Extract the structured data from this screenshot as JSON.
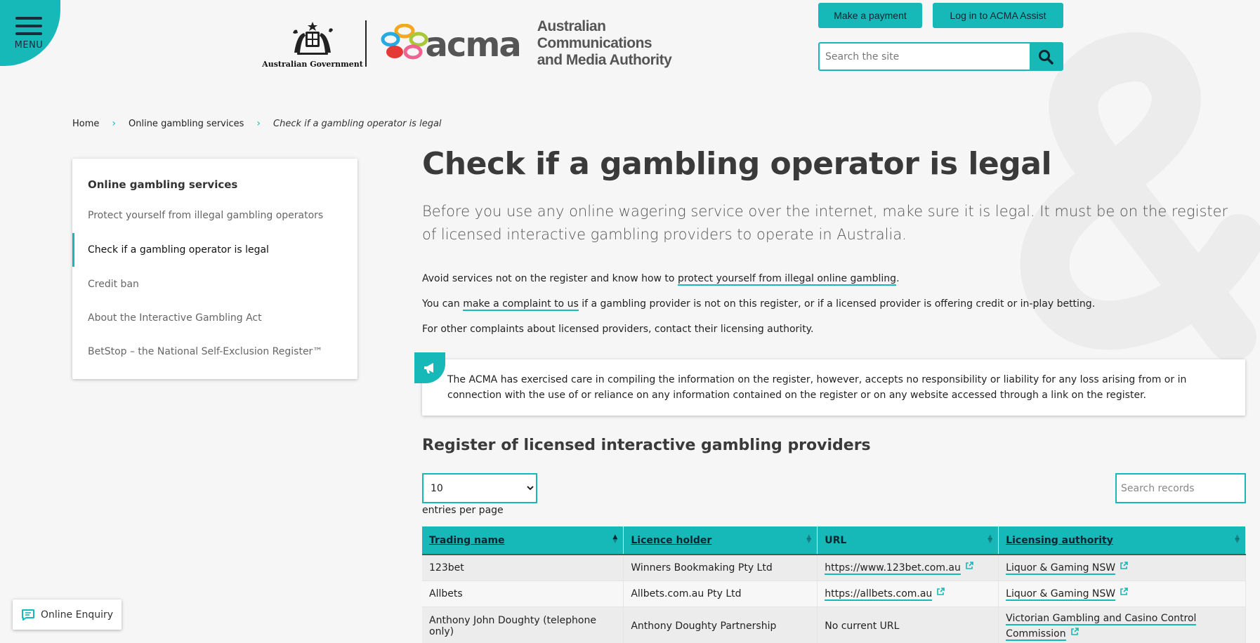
{
  "menu": {
    "label": "MENU"
  },
  "logo": {
    "govt_text": "Australian Government",
    "acma_word": "acma",
    "acma_name": [
      "Australian",
      "Communications",
      "and Media Authority"
    ]
  },
  "header": {
    "payment_label": "Make a payment",
    "login_label": "Log in to ACMA Assist",
    "search_placeholder": "Search the site"
  },
  "breadcrumb": {
    "home": "Home",
    "section": "Online gambling services",
    "current": "Check if a gambling operator is legal"
  },
  "sidenav": {
    "title": "Online gambling services",
    "items": [
      {
        "label": "Protect yourself from illegal gambling operators"
      },
      {
        "label": "Check if a gambling operator is legal"
      },
      {
        "label": "Credit ban"
      },
      {
        "label": "About the Interactive Gambling Act"
      },
      {
        "label": "BetStop – the National Self-Exclusion Register™"
      }
    ]
  },
  "main": {
    "title": "Check if a gambling operator is legal",
    "lead": "Before you use any online wagering service over the internet, make sure it is legal. It must be on the register of licensed interactive gambling providers to operate in Australia.",
    "para1_before": "Avoid services not on the register and know how to ",
    "para1_link": "protect yourself from illegal online gambling",
    "para1_after": ".",
    "para2_before": "You can ",
    "para2_link": "make a complaint to us",
    "para2_after": " if a gambling provider is not on this register, or if a licensed provider is offering credit or in-play betting.",
    "para3": "For other complaints about licensed providers, contact their licensing authority."
  },
  "notice": {
    "text": "The ACMA has exercised care in compiling the information on the register, however, accepts no responsibility or liability for any loss arising from or in connection with the use of or reliance on any information contained on the register or on any website accessed through a link on the register."
  },
  "register": {
    "title": "Register of licensed interactive gambling providers",
    "per_page_value": "10",
    "per_page_label": "entries per page",
    "search_placeholder": "Search records",
    "columns": [
      "Trading name",
      "Licence holder",
      "URL",
      "Licensing authority"
    ],
    "rows": [
      {
        "trading_name": "123bet",
        "licence_holder": "Winners Bookmaking Pty Ltd",
        "url": "https://www.123bet.com.au",
        "authority": "Liquor & Gaming NSW"
      },
      {
        "trading_name": "Allbets",
        "licence_holder": "Allbets.com.au Pty Ltd",
        "url": "https://allbets.com.au",
        "authority": "Liquor & Gaming NSW"
      },
      {
        "trading_name": "Anthony John Doughty (telephone only)",
        "licence_holder": "Anthony Doughty Partnership",
        "url_text": "No current URL",
        "authority_line1": "Victorian Gambling and Casino Control",
        "authority_line2": "Commission"
      }
    ]
  },
  "enquiry": {
    "label": "Online Enquiry"
  },
  "colors": {
    "accent": "#17b8b8",
    "background": "#f6f6f6",
    "title": "#3a3a3a"
  }
}
